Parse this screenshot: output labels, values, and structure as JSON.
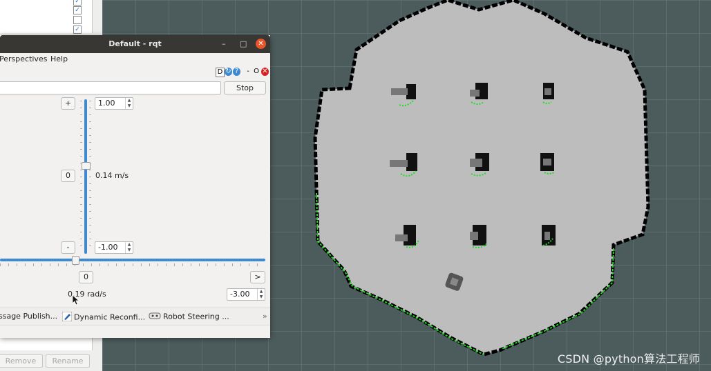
{
  "left_panel": {
    "checkboxes": [
      true,
      true,
      false,
      true
    ],
    "buttons": {
      "remove": "Remove",
      "rename": "Rename"
    }
  },
  "rqt": {
    "window_title": "Default - rqt",
    "window_buttons": {
      "minimize": "–",
      "maximize": "□",
      "close": "✕"
    },
    "menu": {
      "perspectives": "Perspectives",
      "help": "Help"
    },
    "plugin_bar": {
      "d": "D",
      "dash": "-",
      "o": "O"
    },
    "topic_value": "",
    "stop_label": "Stop",
    "linear": {
      "plus_label": "+",
      "zero_label": "0",
      "minus_label": "-",
      "max_value": "1.00",
      "min_value": "-1.00",
      "current": "0.14 m/s",
      "level": 0.57
    },
    "angular": {
      "zero_label": "0",
      "right_label": ">",
      "current": "0.19 rad/s",
      "min_value": "-3.00",
      "level": 0.27
    },
    "tabs": [
      {
        "label": "ssage Publish...",
        "icon": "message-publisher-icon"
      },
      {
        "label": "Dynamic Reconfi...",
        "icon": "pencil-icon"
      },
      {
        "label": "Robot Steering ...",
        "icon": "gamepad-icon"
      }
    ],
    "more_tabs": "»"
  },
  "watermark": "CSDN @python算法工程师",
  "colors": {
    "accent": "#3d8ad0",
    "map_free": "#bdbdbd",
    "grid_bg": "#4c5c5c",
    "laser": "#22dd22",
    "titlebar": "#383734",
    "close": "#e9562a"
  }
}
